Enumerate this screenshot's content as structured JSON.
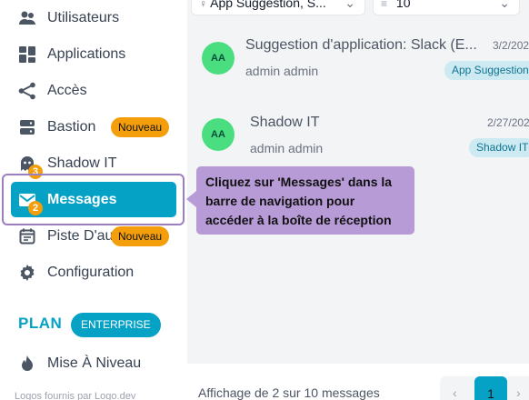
{
  "sidebar": {
    "items": [
      {
        "label": "Utilisateurs",
        "icon": "users-icon"
      },
      {
        "label": "Applications",
        "icon": "grid-icon"
      },
      {
        "label": "Accès",
        "icon": "share-icon"
      },
      {
        "label": "Bastion",
        "icon": "server-icon",
        "badge": "Nouveau"
      },
      {
        "label": "Shadow IT",
        "icon": "ghost-icon",
        "count": "3"
      },
      {
        "label": "Messages",
        "icon": "mail-icon",
        "count": "2",
        "active": true
      },
      {
        "label": "Piste D'au",
        "icon": "calendar-icon",
        "badge": "Nouveau"
      },
      {
        "label": "Configuration",
        "icon": "gear-icon"
      }
    ],
    "plan_label": "PLAN",
    "plan_badge": "ENTERPRISE",
    "upgrade_label": "Mise À Niveau",
    "footer": "Logos fournis par Logo.dev"
  },
  "filters": {
    "app_filter": "App Suggestion, S...",
    "page_size": "10"
  },
  "messages": [
    {
      "avatar": "AA",
      "title": "Suggestion d'application: Slack (E...",
      "from": "admin admin",
      "date": "3/2/202",
      "tag": "App Suggestion"
    },
    {
      "avatar": "AA",
      "title": "Shadow IT",
      "from": "admin admin",
      "date": "2/27/202",
      "tag": "Shadow IT"
    }
  ],
  "pagination": {
    "summary": "Affichage de 2 sur 10 messages",
    "prev": "‹",
    "current": "1",
    "next": "›"
  },
  "tooltip": {
    "text": "Cliquez sur 'Messages' dans la barre de navigation pour accéder à la boîte de réception"
  },
  "colors": {
    "accent": "#06a2c6",
    "badge": "#f59e0b",
    "tooltip": "#b79bd6",
    "avatar": "#4ade80"
  }
}
